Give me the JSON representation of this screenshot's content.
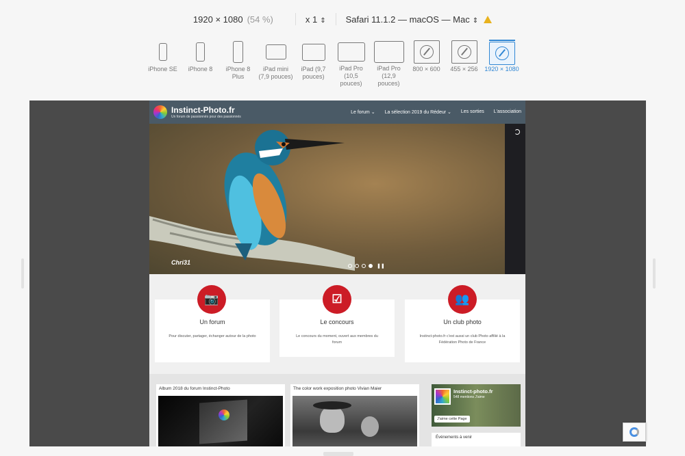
{
  "toolbar": {
    "resolution": "1920 × 1080",
    "zoom": "(54 %)",
    "scale": "x 1",
    "browser": "Safari 11.1.2 — macOS — Mac"
  },
  "devices": [
    {
      "label": "iPhone SE"
    },
    {
      "label": "iPhone 8"
    },
    {
      "label": "iPhone 8 Plus"
    },
    {
      "label": "iPad mini (7,9 pouces)"
    },
    {
      "label": "iPad (9,7 pouces)"
    },
    {
      "label": "iPad Pro (10,5 pouces)"
    },
    {
      "label": "iPad Pro (12,9 pouces)"
    },
    {
      "label": "800 × 600"
    },
    {
      "label": "455 × 256"
    },
    {
      "label": "1920 × 1080"
    }
  ],
  "site": {
    "brand": "Instinct-Photo.fr",
    "tagline": "Un forum de passionnés pour des passionnés",
    "nav": [
      "Le forum ⌄",
      "La sélection 2019 du Rédeur ⌄",
      "Les sorties",
      "L'association"
    ],
    "hero_credit": "Chri31",
    "features": [
      {
        "icon": "📷",
        "title": "Un forum",
        "desc": "Pour discuter, partager, échanger autour de la photo"
      },
      {
        "icon": "☑",
        "title": "Le concours",
        "desc": "Le concours du moment, ouvert aux membres du forum"
      },
      {
        "icon": "👥",
        "title": "Un club photo",
        "desc": "Instinct-photo.fr c'est aussi un club Photo affilié à la Fédération Photo de France"
      }
    ],
    "posts": [
      {
        "title": "Album 2018 du forum Instinct-Photo"
      },
      {
        "title": "The color work exposition photo Vivian Maier"
      }
    ],
    "fb": {
      "name": "Instinct-photo.fr",
      "meta": "548 mentions J'aime",
      "like": "J'aime cette Page"
    },
    "events": "Événements à venir"
  },
  "colors": {
    "accent": "#2f86d4",
    "brand_red": "#cc1c26",
    "nav": "#4a5a66"
  }
}
